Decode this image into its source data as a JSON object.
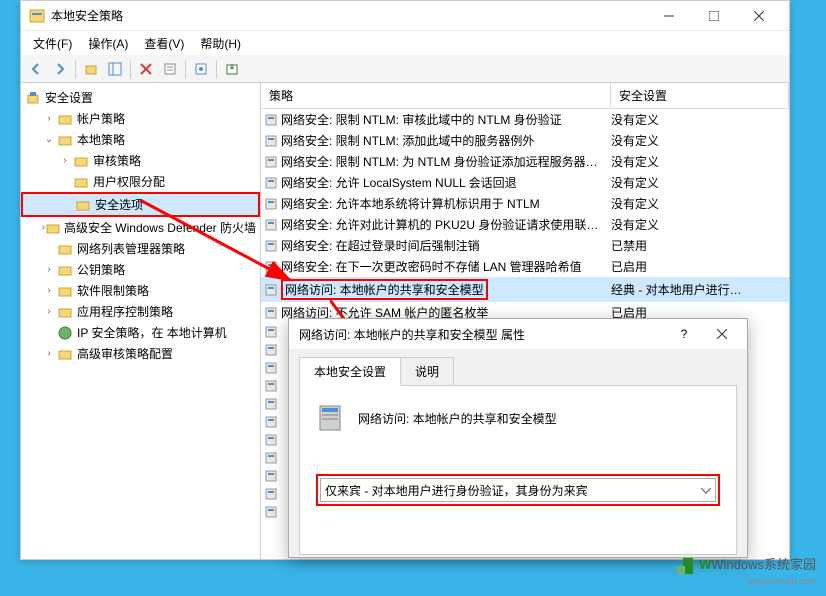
{
  "window": {
    "title": "本地安全策略"
  },
  "menubar": {
    "file": "文件(F)",
    "action": "操作(A)",
    "view": "查看(V)",
    "help": "帮助(H)"
  },
  "tree": {
    "root": "安全设置",
    "items": [
      {
        "label": "帐户策略",
        "indent": 1,
        "toggle": "›"
      },
      {
        "label": "本地策略",
        "indent": 1,
        "toggle": "⌄",
        "bold": true
      },
      {
        "label": "审核策略",
        "indent": 2,
        "toggle": "›"
      },
      {
        "label": "用户权限分配",
        "indent": 2,
        "toggle": ""
      },
      {
        "label": "安全选项",
        "indent": 2,
        "toggle": "",
        "selected": true
      },
      {
        "label": "高级安全 Windows Defender 防火墙",
        "indent": 1,
        "toggle": "›"
      },
      {
        "label": "网络列表管理器策略",
        "indent": 1,
        "toggle": ""
      },
      {
        "label": "公钥策略",
        "indent": 1,
        "toggle": "›"
      },
      {
        "label": "软件限制策略",
        "indent": 1,
        "toggle": "›"
      },
      {
        "label": "应用程序控制策略",
        "indent": 1,
        "toggle": "›"
      },
      {
        "label": "IP 安全策略，在 本地计算机",
        "indent": 1,
        "toggle": "",
        "ip": true
      },
      {
        "label": "高级审核策略配置",
        "indent": 1,
        "toggle": "›"
      }
    ]
  },
  "list": {
    "header_policy": "策略",
    "header_setting": "安全设置",
    "rows": [
      {
        "policy": "网络安全: 限制 NTLM: 审核此域中的 NTLM 身份验证",
        "setting": "没有定义"
      },
      {
        "policy": "网络安全: 限制 NTLM: 添加此域中的服务器例外",
        "setting": "没有定义"
      },
      {
        "policy": "网络安全: 限制 NTLM: 为 NTLM 身份验证添加远程服务器…",
        "setting": "没有定义"
      },
      {
        "policy": "网络安全: 允许 LocalSystem NULL 会话回退",
        "setting": "没有定义"
      },
      {
        "policy": "网络安全: 允许本地系统将计算机标识用于 NTLM",
        "setting": "没有定义"
      },
      {
        "policy": "网络安全: 允许对此计算机的 PKU2U 身份验证请求使用联…",
        "setting": "没有定义"
      },
      {
        "policy": "网络安全: 在超过登录时间后强制注销",
        "setting": "已禁用"
      },
      {
        "policy": "网络安全: 在下一次更改密码时不存储 LAN 管理器哈希值",
        "setting": "已启用"
      },
      {
        "policy": "网络访问: 本地帐户的共享和安全模型",
        "setting": "经典 - 对本地用户进行…",
        "selected": true,
        "highlight": true
      },
      {
        "policy": "网络访问: 不允许 SAM 帐户的匿名枚举",
        "setting": "已启用"
      }
    ]
  },
  "dialog": {
    "title": "网络访问: 本地帐户的共享和安全模型 属性",
    "tab1": "本地安全设置",
    "tab2": "说明",
    "body_title": "网络访问: 本地帐户的共享和安全模型",
    "combo_value": "仅来宾 - 对本地用户进行身份验证，其身份为来宾"
  },
  "watermark": {
    "main": "Windows系统家园",
    "sub": "www.ruiruifu.com"
  }
}
